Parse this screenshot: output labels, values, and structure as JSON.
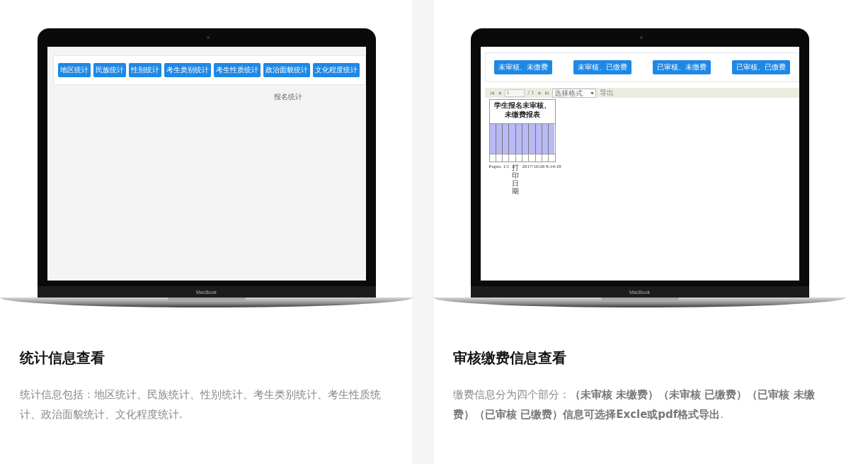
{
  "sections": [
    {
      "device_label": "MacBook",
      "screen": {
        "kind": "stats",
        "buttons": [
          "地区统计",
          "民族统计",
          "性别统计",
          "考生类别统计",
          "考生性质统计",
          "政治面貌统计",
          "文化程度统计"
        ],
        "caption": "报名统计"
      },
      "title": "统计信息查看",
      "description": "统计信息包括：地区统计、民族统计、性别统计、考生类别统计、考生性质统计、政治面貌统计、文化程度统计."
    },
    {
      "device_label": "MacBook",
      "screen": {
        "kind": "report",
        "buttons": [
          "未审核、未缴费",
          "未审核、已缴费",
          "已审核、未缴费",
          "已审核、已缴费"
        ],
        "toolbar": {
          "page": "1",
          "page_total": "/ 1",
          "format_placeholder": "选择格式",
          "export": "导出"
        },
        "report": {
          "title": "学生报名未审核、未缴费报表",
          "pages": "Pages: 1/1",
          "print_label": "打印日期",
          "print_time": "2017/10/26 9:14:18"
        }
      },
      "title": "审核缴费信息查看",
      "description": "缴费信息分为四个部分：**（未审核 未缴费）（未审核 已缴费）（已审核 未缴费）（已审核 已缴费）信息可选择Excle或pdf格式导出**."
    }
  ]
}
